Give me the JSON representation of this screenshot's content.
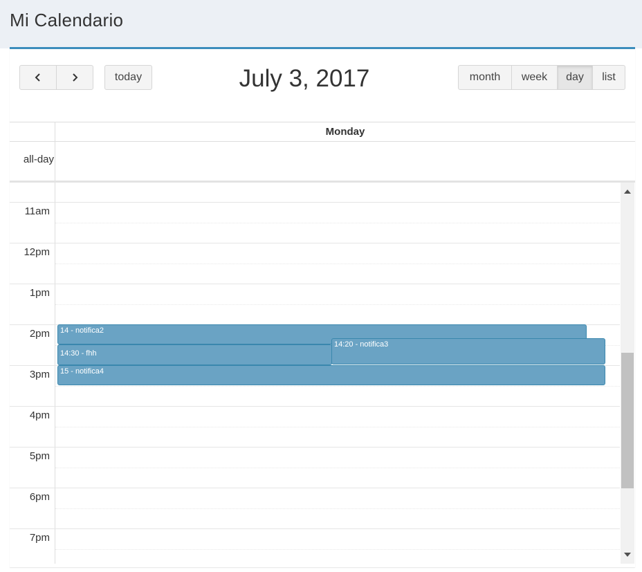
{
  "page": {
    "title": "Mi Calendario"
  },
  "toolbar": {
    "prev_icon": "chevron-left-icon",
    "next_icon": "chevron-right-icon",
    "today_label": "today",
    "title": "July 3, 2017",
    "views": [
      {
        "label": "month",
        "active": false
      },
      {
        "label": "week",
        "active": false
      },
      {
        "label": "day",
        "active": true
      },
      {
        "label": "list",
        "active": false
      }
    ]
  },
  "calendar": {
    "day_header": "Monday",
    "allday_label": "all-day",
    "time_labels": [
      "11am",
      "12pm",
      "1pm",
      "2pm",
      "3pm",
      "4pm",
      "5pm",
      "6pm",
      "7pm"
    ],
    "events": [
      {
        "label": "14 - notifica2"
      },
      {
        "label": "14:20 - notifica3"
      },
      {
        "label": "14:30 - fhh"
      },
      {
        "label": "15 - notifica4"
      }
    ]
  },
  "colors": {
    "accent": "#3c8dbc",
    "event_bg": "#6aa3c4",
    "event_border": "#3a87ad"
  }
}
